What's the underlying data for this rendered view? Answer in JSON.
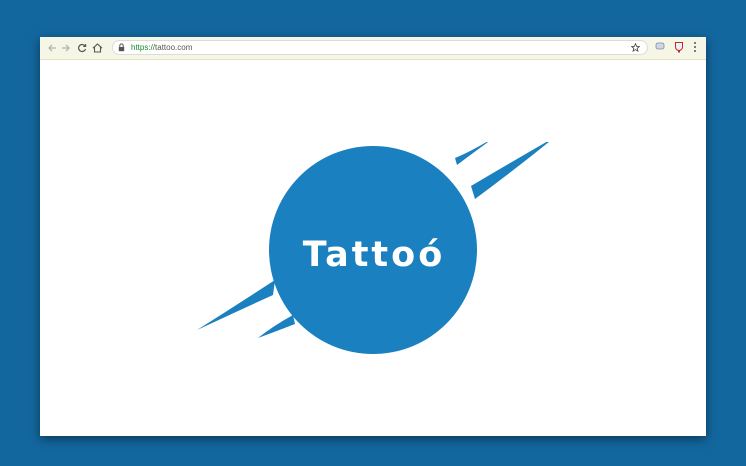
{
  "browser": {
    "url_scheme": "https://",
    "url_host": "tattoo.com",
    "icons": {
      "back": "arrow-left-icon",
      "forward": "arrow-right-icon",
      "reload": "reload-icon",
      "home": "home-icon",
      "lock": "lock-icon",
      "bookmark": "star-icon",
      "extension_1": "extension-icon",
      "extension_2": "extension-icon",
      "menu": "kebab-menu-icon"
    }
  },
  "page": {
    "logo_text": "Tattoó",
    "colors": {
      "brand_blue": "#1b80bf",
      "desktop_background": "#13679f",
      "toolbar": "#f6f6e6"
    }
  }
}
